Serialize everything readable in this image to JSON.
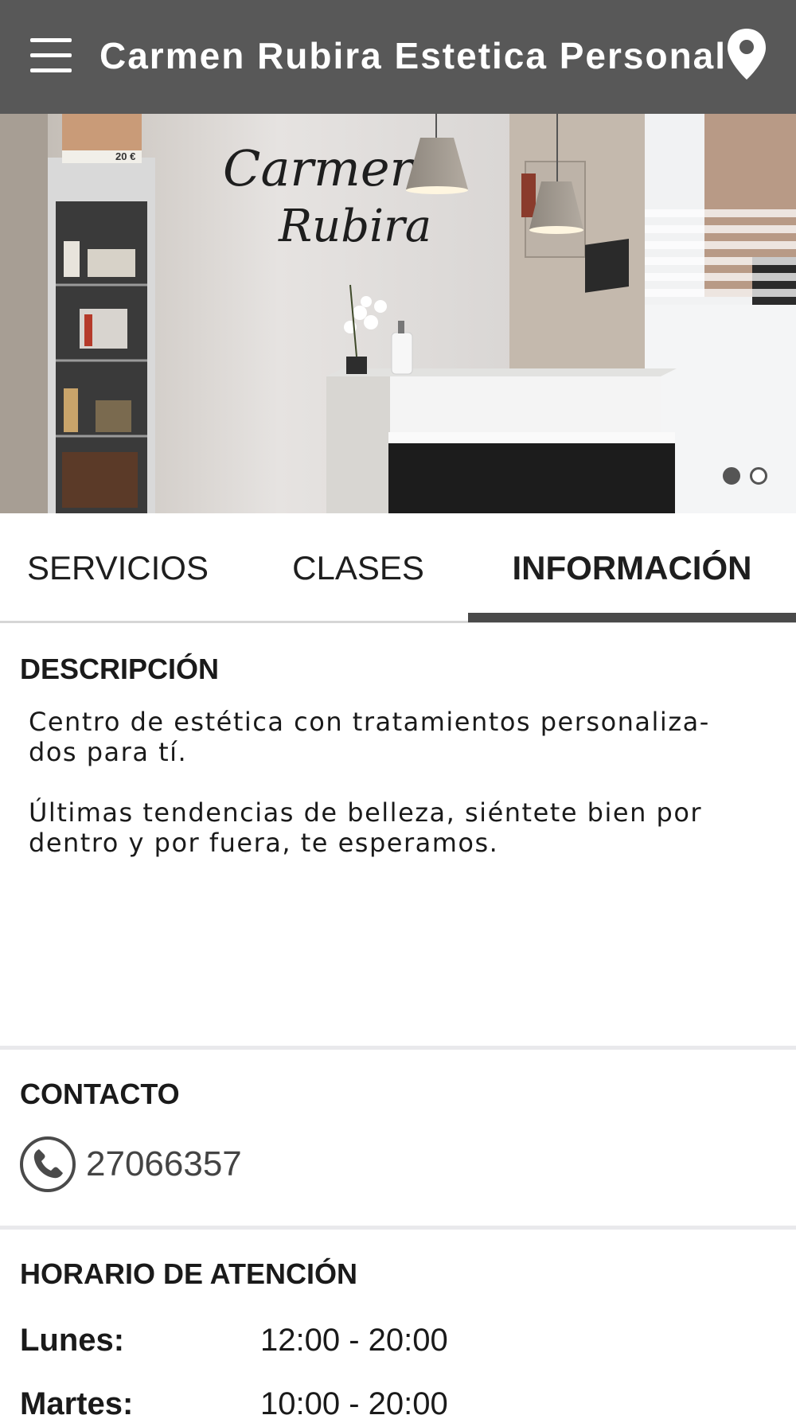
{
  "appbar": {
    "title": "Carmen Rubira Estetica Personal",
    "menu_icon": "hamburger-menu-icon",
    "location_icon": "map-pin-icon",
    "background": "#585858"
  },
  "hero": {
    "sign_line1": "Carmen",
    "sign_line2": "Rubira",
    "price_tag": "20 €",
    "slides": 2,
    "active_slide": 1
  },
  "tabs": [
    {
      "label": "SERVICIOS",
      "active": false
    },
    {
      "label": "CLASES",
      "active": false
    },
    {
      "label": "INFORMACIÓN",
      "active": true
    }
  ],
  "description": {
    "title": "DESCRIPCIÓN",
    "line1": "Centro de estética con tratamientos personaliza-",
    "line2": "dos para tí.",
    "line3": "Últimas tendencias de belleza, siéntete bien por",
    "line4": "dentro y por fuera, te esperamos."
  },
  "contact": {
    "title": "CONTACTO",
    "phone_icon": "phone-icon",
    "phone": "27066357"
  },
  "hours": {
    "title": "HORARIO DE ATENCIÓN",
    "rows": [
      {
        "day": "Lunes:",
        "time": "12:00 - 20:00"
      },
      {
        "day": "Martes:",
        "time": "10:00 - 20:00"
      }
    ]
  }
}
